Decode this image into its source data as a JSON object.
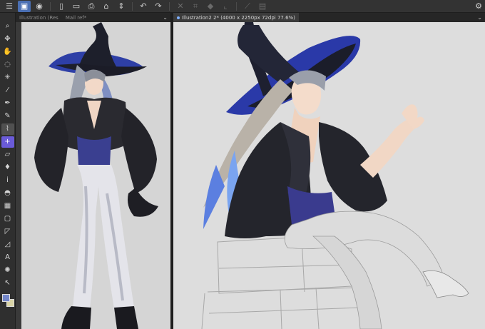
{
  "tabs": {
    "left": [
      {
        "label": "Illustration (Res"
      },
      {
        "label": "Mail ref*"
      }
    ],
    "right": [
      {
        "label": "Illustration2 2* (4000 x 2250px 72dpi 77.6%)"
      }
    ]
  },
  "icons": {
    "command_bar": [
      "menu-icon",
      "canvas-icon",
      "record-icon",
      "new-file-icon",
      "open-folder-icon",
      "save-icon",
      "upload-icon",
      "spin-icon",
      "undo-icon",
      "redo-icon",
      "clear-icon",
      "transform-icon",
      "fill-icon",
      "crop-icon",
      "ruler-icon",
      "layer-icon",
      "settings-icon"
    ],
    "tools": [
      "zoom-icon",
      "move-icon",
      "hand-icon",
      "lasso-icon",
      "select-icon",
      "magic-wand-icon",
      "pen-icon",
      "pencil-icon",
      "brush-icon",
      "airbrush-icon",
      "decoration-icon",
      "eraser-icon",
      "blend-icon",
      "eyedropper-icon",
      "fill-bucket-icon",
      "gradient-icon",
      "figure-icon",
      "frame-icon",
      "ruler-tool-icon",
      "text-icon",
      "balloon-icon",
      "correction-icon"
    ]
  },
  "colors": {
    "main": "#7386c9",
    "sub": "#d9d4a6",
    "accent": "#4a6fb3",
    "active_tool": "#6a5bd8"
  }
}
